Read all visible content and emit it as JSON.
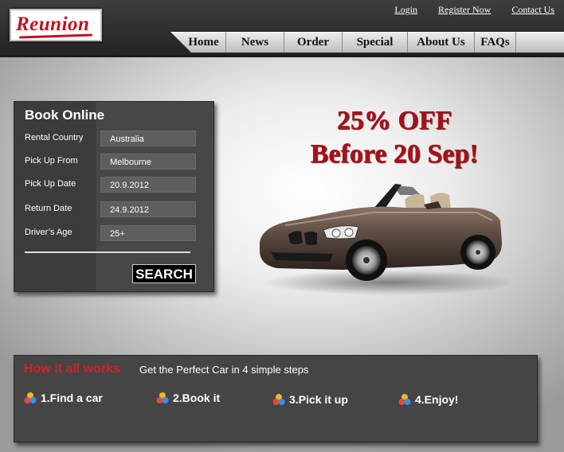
{
  "header": {
    "logo_text": "Reunion",
    "top_links": [
      "Login",
      "Register Now",
      "Contact Us"
    ],
    "nav": [
      "Home",
      "News",
      "Order",
      "Special",
      "About Us",
      "FAQs"
    ]
  },
  "booking": {
    "title": "Book Online",
    "fields": [
      {
        "label": "Rental Country",
        "value": "Australia"
      },
      {
        "label": "Pick Up From",
        "value": "Melbourne"
      },
      {
        "label": "Pick Up Date",
        "value": "20.9.2012"
      },
      {
        "label": "Return Date",
        "value": "24.9.2012"
      },
      {
        "label": "Driver’s Age",
        "value": "25+"
      }
    ],
    "search_label": "SEARCH"
  },
  "promo": {
    "line1": "25% OFF",
    "line2": "Before 20 Sep!"
  },
  "how": {
    "title": "How it all works",
    "subtitle": "Get the Perfect Car in 4 simple steps",
    "steps": [
      "1.Find a car",
      "2.Book it",
      "3.Pick it up",
      "4.Enjoy!"
    ]
  },
  "colors": {
    "brand_red": "#c1121f",
    "promo_red": "#a3121c",
    "panel_dark": "#3c3c3c",
    "header_dark": "#2e2e2e"
  },
  "icons": {
    "step_icon": "tricolor-dots-icon",
    "promo_image": "convertible-car-icon"
  }
}
